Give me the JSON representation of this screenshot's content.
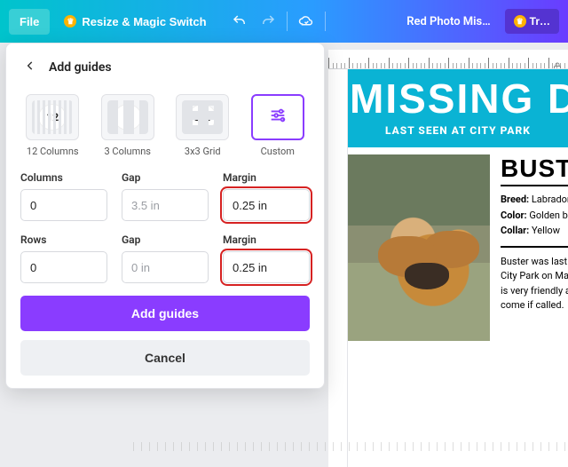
{
  "topbar": {
    "file": "File",
    "magic": "Resize & Magic Switch",
    "title": "Red Photo Mis…",
    "tr": "Tr…"
  },
  "panel": {
    "title": "Add guides",
    "presets": {
      "cols12": {
        "value": "12",
        "label": "12 Columns"
      },
      "cols3": {
        "value": "3",
        "label": "3 Columns"
      },
      "grid3": {
        "value": "3x3",
        "label": "3x3 Grid"
      },
      "custom": {
        "label": "Custom"
      }
    },
    "labels": {
      "columns": "Columns",
      "rows": "Rows",
      "gap": "Gap",
      "margin": "Margin"
    },
    "values": {
      "columns": "0",
      "col_gap": "3.5 in",
      "col_margin": "0.25 in",
      "rows": "0",
      "row_gap": "0 in",
      "row_margin": "0.25 in"
    },
    "add": "Add guides",
    "cancel": "Cancel"
  },
  "poster": {
    "banner_title": "MISSING DO",
    "banner_sub": "LAST SEEN AT CITY PARK",
    "dog_name": "BUSTER",
    "breed_k": "Breed:",
    "breed_v": "Labrador",
    "color_k": "Color:",
    "color_v": "Golden br",
    "collar_k": "Collar:",
    "collar_v": "Yellow",
    "desc": "Buster was last s\nCity Park on Mar\nis very friendly a\ncome if called."
  }
}
